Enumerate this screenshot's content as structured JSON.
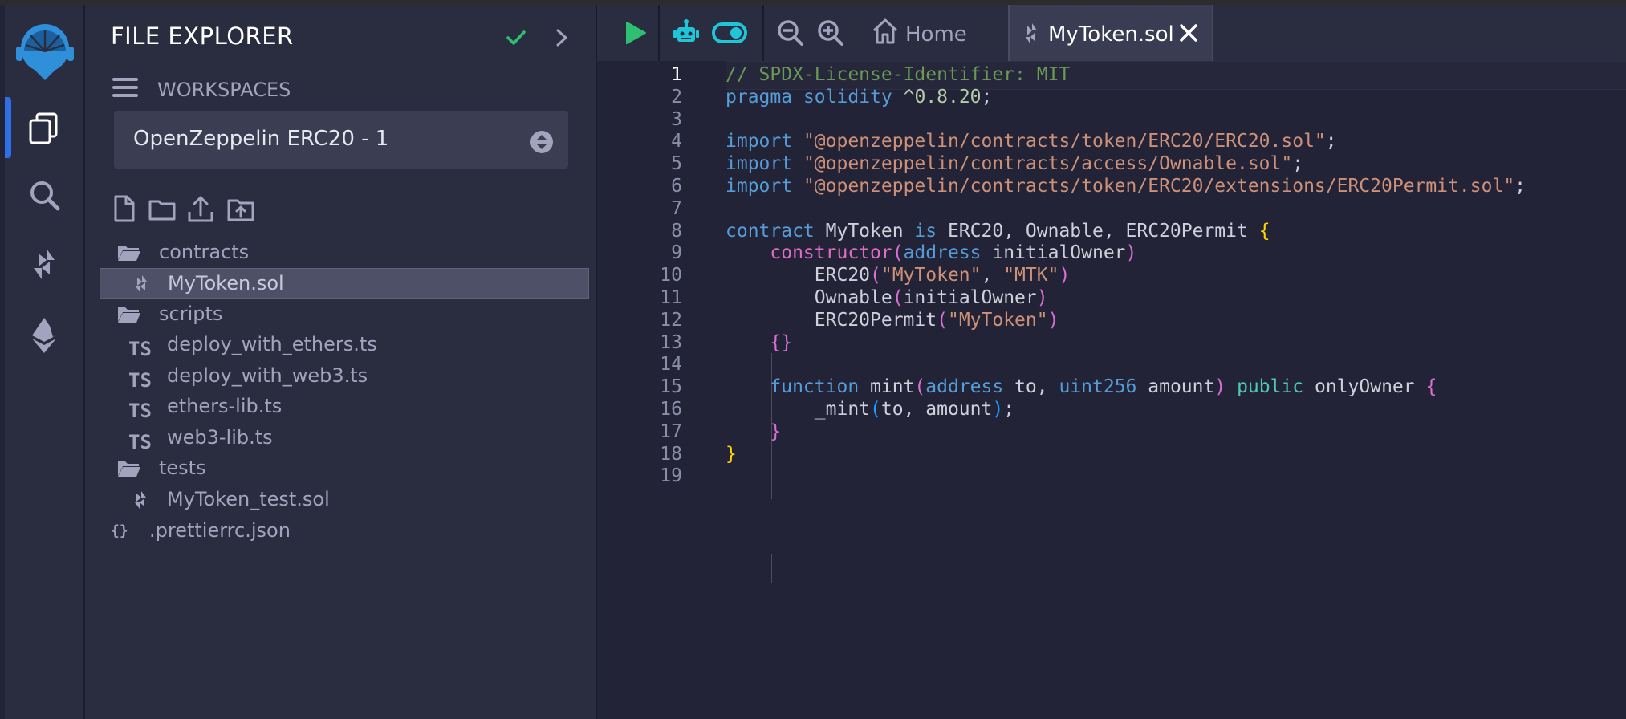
{
  "explorer": {
    "title": "FILE EXPLORER",
    "workspaces_label": "WORKSPACES",
    "workspace_selected": "OpenZeppelin ERC20 - 1",
    "tree": [
      {
        "label": "contracts",
        "kind": "folder",
        "depth": 0
      },
      {
        "label": "MyToken.sol",
        "kind": "sol",
        "depth": 1,
        "selected": true
      },
      {
        "label": "scripts",
        "kind": "folder",
        "depth": 0
      },
      {
        "label": "deploy_with_ethers.ts",
        "kind": "ts",
        "depth": 1
      },
      {
        "label": "deploy_with_web3.ts",
        "kind": "ts",
        "depth": 1
      },
      {
        "label": "ethers-lib.ts",
        "kind": "ts",
        "depth": 1
      },
      {
        "label": "web3-lib.ts",
        "kind": "ts",
        "depth": 1
      },
      {
        "label": "tests",
        "kind": "folder",
        "depth": 0
      },
      {
        "label": "MyToken_test.sol",
        "kind": "sol",
        "depth": 1
      },
      {
        "label": ".prettierrc.json",
        "kind": "json",
        "depth": 0
      }
    ],
    "ts_badge": "TS",
    "json_badge": "{}"
  },
  "tabs": {
    "home_label": "Home",
    "active_file": "MyToken.sol"
  },
  "colors": {
    "accent": "#2e6ee6",
    "run_green": "#2fbf71",
    "cyan": "#20c5d8",
    "check_green": "#2fbf71"
  },
  "editor": {
    "current_line": 1,
    "lines": [
      [
        {
          "t": "// SPDX-License-Identifier: MIT",
          "c": "#6a9955"
        }
      ],
      [
        {
          "t": "pragma",
          "c": "#569cd6"
        },
        {
          "t": " "
        },
        {
          "t": "solidity",
          "c": "#569cd6"
        },
        {
          "t": " "
        },
        {
          "t": "^0.8.20",
          "c": "#b5cea8"
        },
        {
          "t": ";"
        }
      ],
      [],
      [
        {
          "t": "import",
          "c": "#569cd6"
        },
        {
          "t": " "
        },
        {
          "t": "\"@openzeppelin/contracts/token/ERC20/ERC20.sol\"",
          "c": "#ce9178"
        },
        {
          "t": ";"
        }
      ],
      [
        {
          "t": "import",
          "c": "#569cd6"
        },
        {
          "t": " "
        },
        {
          "t": "\"@openzeppelin/contracts/access/Ownable.sol\"",
          "c": "#ce9178"
        },
        {
          "t": ";"
        }
      ],
      [
        {
          "t": "import",
          "c": "#569cd6"
        },
        {
          "t": " "
        },
        {
          "t": "\"@openzeppelin/contracts/token/ERC20/extensions/ERC20Permit.sol\"",
          "c": "#ce9178"
        },
        {
          "t": ";"
        }
      ],
      [],
      [
        {
          "t": "contract",
          "c": "#569cd6"
        },
        {
          "t": " MyToken "
        },
        {
          "t": "is",
          "c": "#569cd6"
        },
        {
          "t": " ERC20, Ownable, ERC20Permit "
        },
        {
          "t": "{",
          "c": "#ffd700"
        }
      ],
      [
        {
          "t": "    "
        },
        {
          "t": "constructor",
          "c": "#e06cc4"
        },
        {
          "t": "(",
          "c": "#da70d6"
        },
        {
          "t": "address",
          "c": "#569cd6"
        },
        {
          "t": " initialOwner"
        },
        {
          "t": ")",
          "c": "#da70d6"
        }
      ],
      [
        {
          "t": "        ERC20"
        },
        {
          "t": "(",
          "c": "#da70d6"
        },
        {
          "t": "\"MyToken\"",
          "c": "#ce9178"
        },
        {
          "t": ", "
        },
        {
          "t": "\"MTK\"",
          "c": "#ce9178"
        },
        {
          "t": ")",
          "c": "#da70d6"
        }
      ],
      [
        {
          "t": "        Ownable"
        },
        {
          "t": "(",
          "c": "#da70d6"
        },
        {
          "t": "initialOwner"
        },
        {
          "t": ")",
          "c": "#da70d6"
        }
      ],
      [
        {
          "t": "        ERC20Permit"
        },
        {
          "t": "(",
          "c": "#da70d6"
        },
        {
          "t": "\"MyToken\"",
          "c": "#ce9178"
        },
        {
          "t": ")",
          "c": "#da70d6"
        }
      ],
      [
        {
          "t": "    "
        },
        {
          "t": "{}",
          "c": "#da70d6"
        }
      ],
      [],
      [
        {
          "t": "    "
        },
        {
          "t": "function",
          "c": "#569cd6"
        },
        {
          "t": " mint"
        },
        {
          "t": "(",
          "c": "#da70d6"
        },
        {
          "t": "address",
          "c": "#569cd6"
        },
        {
          "t": " to, "
        },
        {
          "t": "uint256",
          "c": "#569cd6"
        },
        {
          "t": " amount"
        },
        {
          "t": ")",
          "c": "#da70d6"
        },
        {
          "t": " "
        },
        {
          "t": "public",
          "c": "#4ec9b0"
        },
        {
          "t": " onlyOwner "
        },
        {
          "t": "{",
          "c": "#da70d6"
        }
      ],
      [
        {
          "t": "        _mint"
        },
        {
          "t": "(",
          "c": "#179fff"
        },
        {
          "t": "to, amount"
        },
        {
          "t": ")",
          "c": "#179fff"
        },
        {
          "t": ";"
        }
      ],
      [
        {
          "t": "    "
        },
        {
          "t": "}",
          "c": "#da70d6"
        }
      ],
      [
        {
          "t": "}",
          "c": "#ffd700"
        }
      ],
      []
    ]
  }
}
